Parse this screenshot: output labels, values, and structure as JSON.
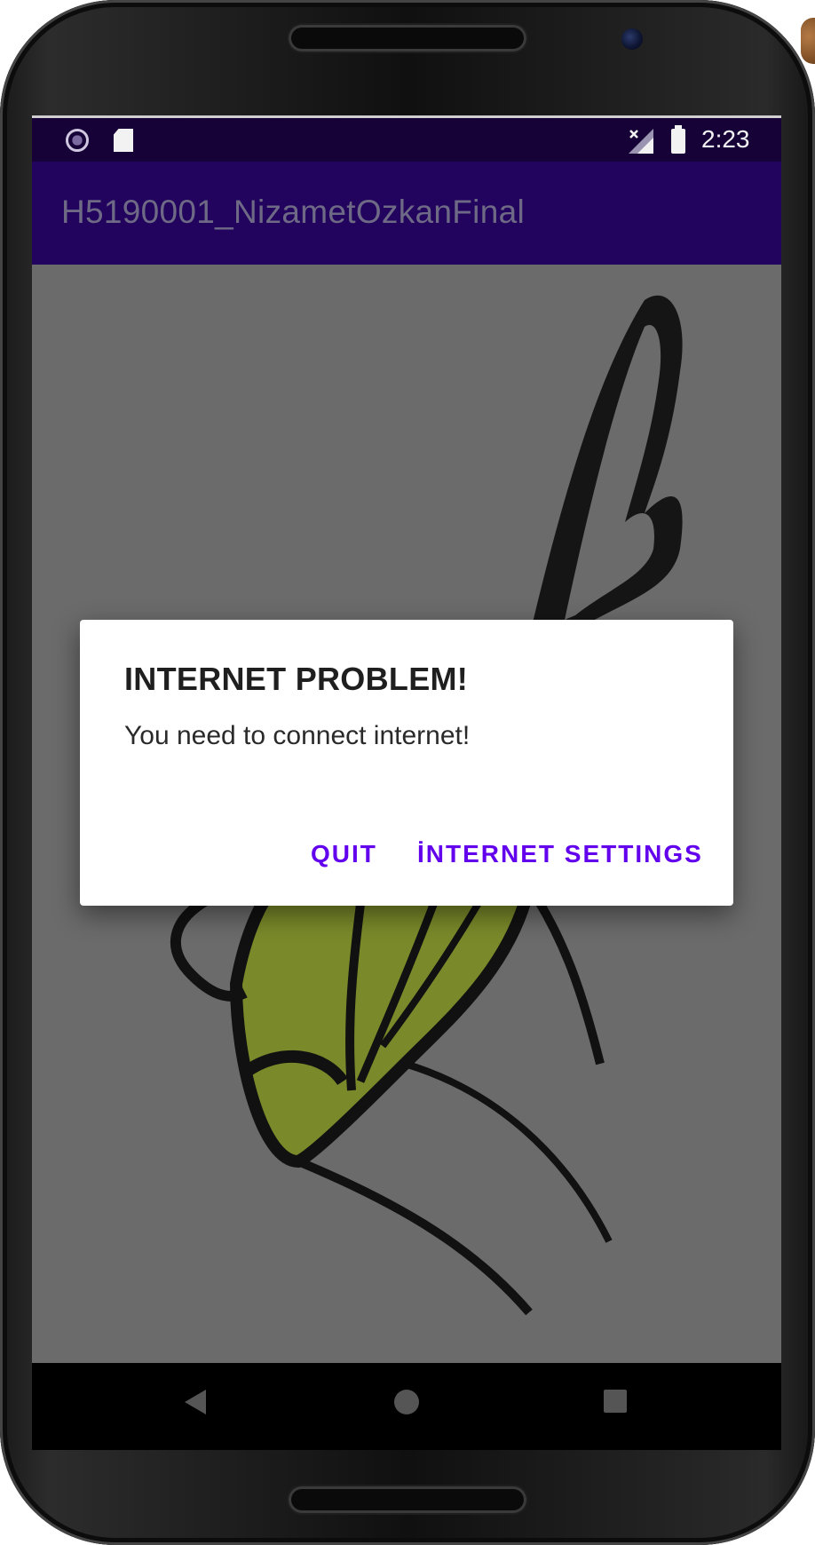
{
  "status_bar": {
    "time": "2:23",
    "icons": [
      "sync-icon",
      "sd-card-icon",
      "no-signal-icon",
      "battery-icon"
    ]
  },
  "app_bar": {
    "title": "H5190001_NizametOzkanFinal"
  },
  "dialog": {
    "title": "INTERNET PROBLEM!",
    "message": "You need to connect internet!",
    "buttons": {
      "quit": "QUIT",
      "settings": "İNTERNET SETTINGS"
    }
  },
  "nav_bar": {
    "icons": [
      "back-icon",
      "home-icon",
      "recents-icon"
    ]
  },
  "colors": {
    "status_bar": "#160236",
    "app_bar": "#22035e",
    "dialog_button": "#6200ee",
    "scrim_content": "#6b6b6b",
    "leaf_green": "#7a8a2a"
  }
}
